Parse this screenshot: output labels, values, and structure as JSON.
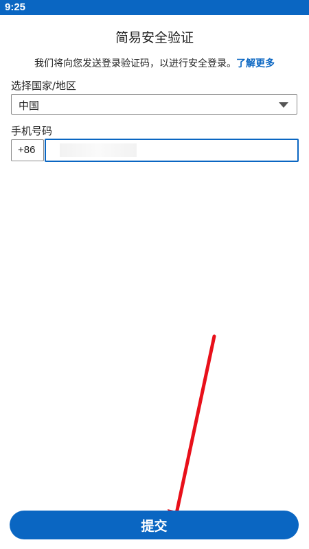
{
  "status_bar": {
    "time": "9:25",
    "color": "#0a66c2"
  },
  "page": {
    "title": "简易安全验证",
    "description": "我们将向您发送登录验证码，以进行安全登录。",
    "learn_more": "了解更多"
  },
  "country_field": {
    "label": "选择国家/地区",
    "selected": "中国",
    "icon": "dropdown-arrow-icon"
  },
  "phone_field": {
    "label": "手机号码",
    "country_code": "+86",
    "value": ""
  },
  "submit": {
    "label": "提交"
  },
  "annotation": {
    "type": "red-arrow",
    "color": "#e8101a",
    "points_to": "submit-button"
  },
  "colors": {
    "accent": "#0a66c2",
    "border": "#8a8a8a",
    "text": "#222222"
  }
}
